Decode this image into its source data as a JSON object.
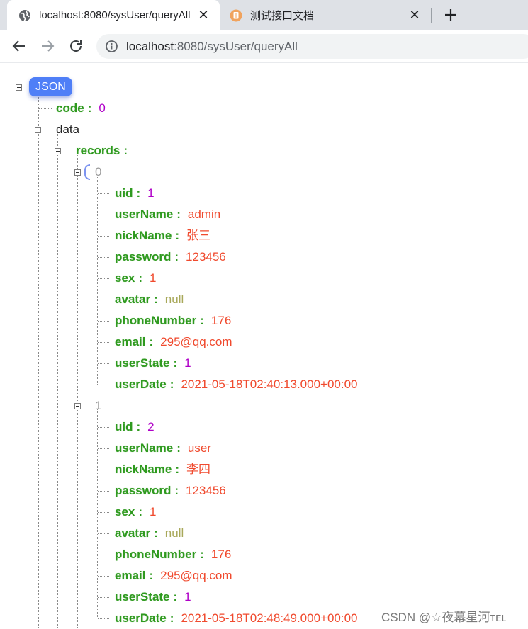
{
  "browser": {
    "tabs": [
      {
        "title": "localhost:8080/sysUser/queryAll",
        "active": true,
        "favicon": "globe-icon"
      },
      {
        "title": "测试接口文档",
        "active": false,
        "favicon": "document-icon"
      }
    ],
    "close_glyph": "✕",
    "address": {
      "host": "localhost",
      "path": ":8080/sysUser/queryAll"
    }
  },
  "json": {
    "root_label": "JSON",
    "code": {
      "key": "code",
      "value": "0"
    },
    "data_key": "data",
    "records_key": "records",
    "records": [
      {
        "index": "0",
        "fields": [
          {
            "key": "uid",
            "value": "1",
            "type": "number"
          },
          {
            "key": "userName",
            "value": "admin",
            "type": "string"
          },
          {
            "key": "nickName",
            "value": "张三",
            "type": "string"
          },
          {
            "key": "password",
            "value": "123456",
            "type": "string"
          },
          {
            "key": "sex",
            "value": "1",
            "type": "string"
          },
          {
            "key": "avatar",
            "value": "null",
            "type": "null"
          },
          {
            "key": "phoneNumber",
            "value": "176",
            "type": "string"
          },
          {
            "key": "email",
            "value": "295@qq.com",
            "type": "string"
          },
          {
            "key": "userState",
            "value": "1",
            "type": "number"
          },
          {
            "key": "userDate",
            "value": "2021-05-18T02:40:13.000+00:00",
            "type": "string"
          }
        ]
      },
      {
        "index": "1",
        "fields": [
          {
            "key": "uid",
            "value": "2",
            "type": "number"
          },
          {
            "key": "userName",
            "value": "user",
            "type": "string"
          },
          {
            "key": "nickName",
            "value": "李四",
            "type": "string"
          },
          {
            "key": "password",
            "value": "123456",
            "type": "string"
          },
          {
            "key": "sex",
            "value": "1",
            "type": "string"
          },
          {
            "key": "avatar",
            "value": "null",
            "type": "null"
          },
          {
            "key": "phoneNumber",
            "value": "176",
            "type": "string"
          },
          {
            "key": "email",
            "value": "295@qq.com",
            "type": "string"
          },
          {
            "key": "userState",
            "value": "1",
            "type": "number"
          },
          {
            "key": "userDate",
            "value": "2021-05-18T02:48:49.000+00:00",
            "type": "string"
          }
        ]
      }
    ]
  },
  "watermark": "CSDN @☆夜幕星河ᴛᴇʟ"
}
